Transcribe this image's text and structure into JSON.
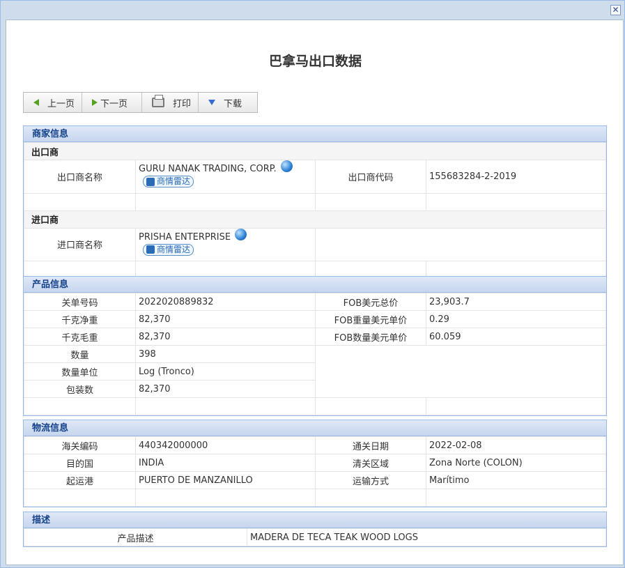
{
  "window": {
    "close_symbol": "✕"
  },
  "page_title": "巴拿马出口数据",
  "toolbar": {
    "prev_label": "上一页",
    "next_label": "下一页",
    "print_label": "打印",
    "download_label": "下载"
  },
  "merchant": {
    "section_title": "商家信息",
    "exporter_heading": "出口商",
    "exporter_name_label": "出口商名称",
    "exporter_name": "GURU NANAK TRADING, CORP.",
    "exporter_code_label": "出口商代码",
    "exporter_code": "155683284-2-2019",
    "importer_heading": "进口商",
    "importer_name_label": "进口商名称",
    "importer_name": "PRISHA ENTERPRISE",
    "radar_label": "商情雷达"
  },
  "product": {
    "section_title": "产品信息",
    "rows_left": [
      {
        "label": "关单号码",
        "value": "2022020889832"
      },
      {
        "label": "千克净重",
        "value": "82,370"
      },
      {
        "label": "千克毛重",
        "value": "82,370"
      },
      {
        "label": "数量",
        "value": "398"
      },
      {
        "label": "数量单位",
        "value": "Log (Tronco)"
      },
      {
        "label": "包装数",
        "value": "82,370"
      }
    ],
    "rows_right": [
      {
        "label": "FOB美元总价",
        "value": "23,903.7"
      },
      {
        "label": "FOB重量美元单价",
        "value": "0.29"
      },
      {
        "label": "FOB数量美元单价",
        "value": "60.059"
      }
    ]
  },
  "logistics": {
    "section_title": "物流信息",
    "rows": [
      {
        "l_label": "海关编码",
        "l_value": "440342000000",
        "r_label": "通关日期",
        "r_value": "2022-02-08"
      },
      {
        "l_label": "目的国",
        "l_value": "INDIA",
        "r_label": "清关区域",
        "r_value": "Zona Norte (COLON)"
      },
      {
        "l_label": "起运港",
        "l_value": "PUERTO DE MANZANILLO",
        "r_label": "运输方式",
        "r_value": "Marítimo"
      }
    ]
  },
  "description": {
    "section_title": "描述",
    "label": "产品描述",
    "value": "MADERA DE TECA TEAK WOOD LOGS"
  }
}
